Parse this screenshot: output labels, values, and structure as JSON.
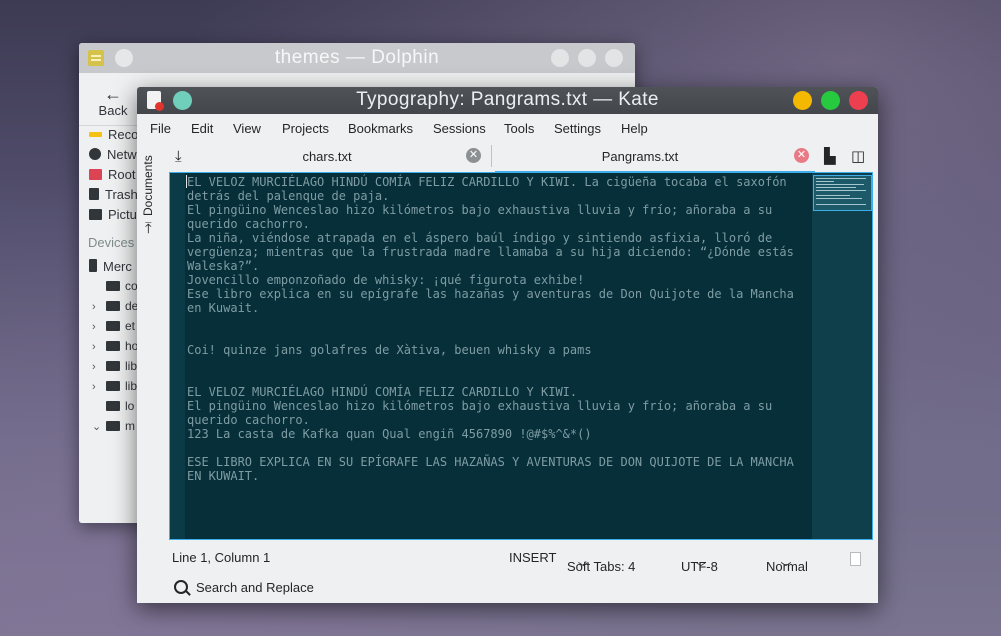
{
  "dolphin": {
    "title": "themes — Dolphin",
    "back_label": "Back",
    "places": [
      {
        "label": "Reco",
        "icon": "recent-icon",
        "color": "#f5c211"
      },
      {
        "label": "Netw",
        "icon": "network-icon",
        "color": "#31363b"
      },
      {
        "label": "Root",
        "icon": "root-folder-icon",
        "color": "#da4453"
      },
      {
        "label": "Trash",
        "icon": "trash-icon",
        "color": "#31363b"
      },
      {
        "label": "Pictu",
        "icon": "pictures-folder-icon",
        "color": "#31363b"
      }
    ],
    "devices_header": "Devices",
    "device": {
      "label": "Merc",
      "icon": "phone-icon"
    },
    "tree": [
      "co",
      "de",
      "et",
      "ho",
      "lib",
      "lib",
      "lo",
      "m"
    ]
  },
  "kate": {
    "title": "Typography: Pangrams.txt — Kate",
    "menu": [
      "File",
      "Edit",
      "View",
      "Projects",
      "Bookmarks",
      "Sessions",
      "Tools",
      "Settings",
      "Help"
    ],
    "sidebar_label": "Documents",
    "tabs": [
      {
        "label": "chars.txt",
        "active": false
      },
      {
        "label": "Pangrams.txt",
        "active": true
      }
    ],
    "lines": [
      "EL VELOZ MURCIÉLAGO HINDÚ COMÍA FELIZ CARDILLO Y KIWI. La cigüeña tocaba el saxofón",
      "detrás del palenque de paja.",
      "El pingüino Wenceslao hizo kilómetros bajo exhaustiva lluvia y frío; añoraba a su",
      "querido cachorro.",
      "La niña, viéndose atrapada en el áspero baúl índigo y sintiendo asfixia, lloró de",
      "vergüenza; mientras que la frustrada madre llamaba a su hija diciendo: “¿Dónde estás",
      "Waleska?”.",
      "Jovencillo emponzoñado de whisky: ¡qué figurota exhibe!",
      "Ese libro explica en su epígrafe las hazañas y aventuras de Don Quijote de la Mancha",
      "en Kuwait.",
      "",
      "",
      "Coi! quinze jans golafres de Xàtiva, beuen whisky a pams",
      "",
      "",
      "EL VELOZ MURCIÉLAGO HINDÚ COMÍA FELIZ CARDILLO Y KIWI.",
      "El pingüino Wenceslao hizo kilómetros bajo exhaustiva lluvia y frío; añoraba a su",
      "querido cachorro.",
      "123 La casta de Kafka quan Qual engiñ 4567890 !@#$%^&*()",
      "",
      "ESE LIBRO EXPLICA EN SU EPÍGRAFE LAS HAZAÑAS Y AVENTURAS DE DON QUIJOTE DE LA MANCHA",
      "EN KUWAIT."
    ],
    "status": {
      "cursor": "Line 1, Column 1",
      "mode": "INSERT",
      "indent": "Soft Tabs: 4",
      "encoding": "UTF-8",
      "highlighting": "Normal"
    },
    "search_replace": "Search and Replace",
    "colors": {
      "accent": "#3daee9",
      "editor_bg": "#062f3a",
      "editor_text": "#7f9ca3",
      "minimize": "#f5b800",
      "maximize": "#27c93f",
      "close": "#ec3f50"
    }
  }
}
